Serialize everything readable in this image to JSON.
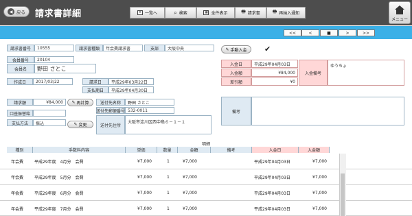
{
  "header": {
    "back_label": "戻る",
    "title": "請求書詳細",
    "toolbar": [
      "一覧へ",
      "検索",
      "全件表示",
      "請求書",
      "再納入通知"
    ],
    "menu_label": "メニュー"
  },
  "pager": [
    "<<",
    "<",
    "■",
    ">",
    ">>"
  ],
  "form": {
    "invoice_no_label": "請求書番号",
    "invoice_no": "10555",
    "invoice_type_label": "請求書種類",
    "invoice_type": "年会費請求書",
    "branch_label": "支部",
    "branch": "大阪中央",
    "member_no_label": "会員番号",
    "member_no": "20104",
    "member_name_label": "会員名",
    "member_name": "野田 さとこ",
    "created_label": "作成日",
    "created": "2017/03/22",
    "billing_date_label": "請求日",
    "billing_date": "平成29年03月22日",
    "due_date_label": "支払期日",
    "due_date": "平成29年04月30日",
    "billed_amount_label": "請求額",
    "billed_amount": "¥84,000",
    "recalc_label": "再計算",
    "account_label": "口座振替銘",
    "account": "",
    "pay_method_label": "支払方法",
    "pay_method": "振込",
    "change_label": "変更",
    "dest_name_label": "送付先名称",
    "dest_name": "野田 さとこ",
    "dest_zip_label": "送付先郵便番号",
    "dest_zip": "532-0011",
    "dest_addr_label": "送付先住所",
    "dest_addr": "大阪市淀川区西中島６－１－１",
    "manual_label": "手動入金",
    "paid_date_label": "入金日",
    "paid_date": "平成29年04月03日",
    "paid_amount_label": "入金額",
    "paid_amount": "¥84,000",
    "balance_label": "差引額",
    "balance": "¥0",
    "paid_note_label": "入金備考",
    "paid_note": "ゆうちょ",
    "remarks_label": "備考",
    "remarks": ""
  },
  "detail": {
    "section_title": "明細",
    "columns": [
      "種別",
      "手数料内容",
      "単価",
      "数量",
      "金額",
      "備考",
      "入金日",
      "入金額"
    ],
    "rows": [
      [
        "年会費",
        "平成29年度　4月分　会費",
        "¥7,000",
        "1",
        "¥7,000",
        "",
        "平成29年04月03日",
        "¥7,000"
      ],
      [
        "年会費",
        "平成29年度　5月分　会費",
        "¥7,000",
        "1",
        "¥7,000",
        "",
        "平成29年04月03日",
        "¥7,000"
      ],
      [
        "年会費",
        "平成29年度　6月分　会費",
        "¥7,000",
        "1",
        "¥7,000",
        "",
        "平成29年04月03日",
        "¥7,000"
      ],
      [
        "年会費",
        "平成29年度　7月分　会費",
        "¥7,000",
        "1",
        "¥7,000",
        "",
        "平成29年04月03日",
        "¥7,000"
      ]
    ]
  },
  "colors": {
    "header": "#4d4d4d",
    "accent_bar": "#3bb0e7",
    "label_blue": "#dfeaf3",
    "label_pink": "#ffd7d7"
  },
  "icons": [
    "back-arrow-icon",
    "list-icon",
    "search-icon",
    "grid-icon",
    "printer-icon",
    "home-icon",
    "pencil-icon",
    "check-icon"
  ]
}
